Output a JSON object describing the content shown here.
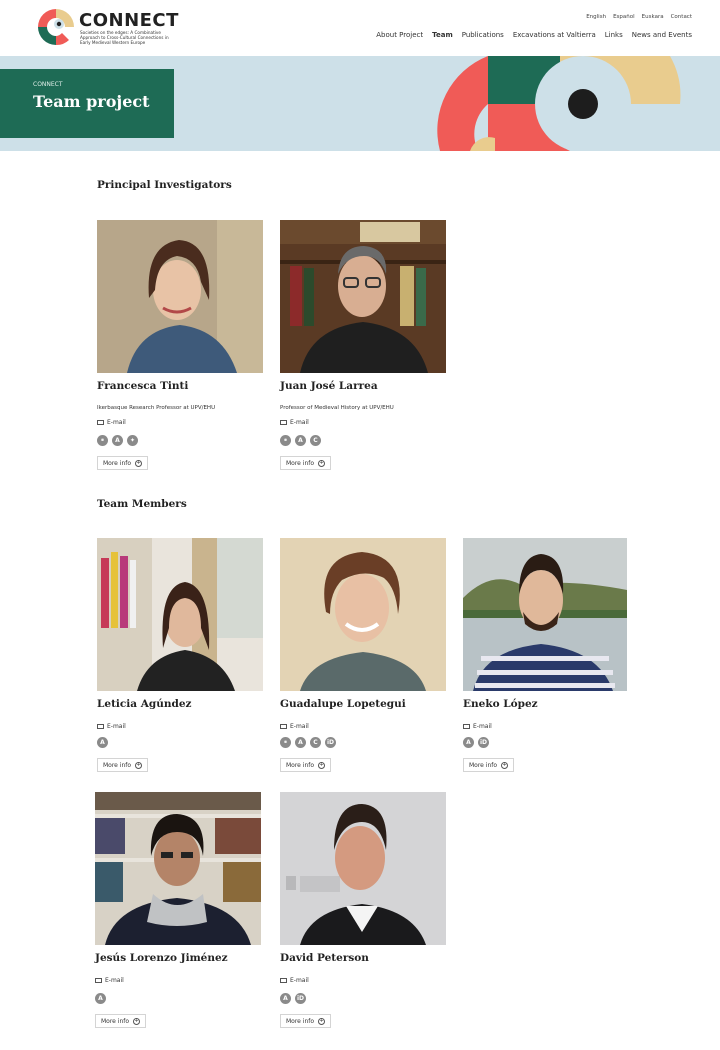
{
  "site": {
    "logo_title": "CONNECT",
    "logo_subtitle": "Societies on the edges: A Combinative Approach to Cross-Cultural Connections in Early Medieval Western Europe"
  },
  "languages": [
    "English",
    "Español",
    "Euskara",
    "Contact"
  ],
  "nav": [
    {
      "label": "About Project",
      "active": false
    },
    {
      "label": "Team",
      "active": true
    },
    {
      "label": "Publications",
      "active": false
    },
    {
      "label": "Excavations at Valtierra",
      "active": false
    },
    {
      "label": "Links",
      "active": false
    },
    {
      "label": "News and Events",
      "active": false
    }
  ],
  "banner": {
    "kicker": "CONNECT",
    "title": "Team project"
  },
  "colors": {
    "green": "#1e6b55",
    "red": "#f05b57",
    "sand": "#e9cc8e",
    "sky": "#cde0e8",
    "icon_gray": "#8a8a8a"
  },
  "sections": {
    "pi_title": "Principal Investigators",
    "members_title": "Team Members"
  },
  "common": {
    "email_label": "E-mail",
    "more_label": "More info"
  },
  "people": [
    {
      "name": "Francesca Tinti",
      "role": "Ikerbasque Research Professor at UPV/EHU",
      "icons": [
        "link-icon",
        "academia-icon",
        "twitter-icon"
      ]
    },
    {
      "name": "Juan José Larrea",
      "role": "Professor of Medieval History at UPV/EHU",
      "icons": [
        "link-icon",
        "academia-icon",
        "copyright-icon"
      ]
    },
    {
      "name": "Leticia Agúndez",
      "role": "",
      "icons": [
        "academia-icon"
      ]
    },
    {
      "name": "Guadalupe Lopetegui",
      "role": "",
      "icons": [
        "link-icon",
        "academia-icon",
        "copyright-icon",
        "orcid-icon"
      ]
    },
    {
      "name": "Eneko López",
      "role": "",
      "icons": [
        "academia-icon",
        "orcid-icon"
      ]
    },
    {
      "name": "Jesús Lorenzo Jiménez",
      "role": "",
      "icons": [
        "academia-icon"
      ]
    },
    {
      "name": "David Peterson",
      "role": "",
      "icons": [
        "academia-icon",
        "orcid-icon"
      ]
    }
  ]
}
